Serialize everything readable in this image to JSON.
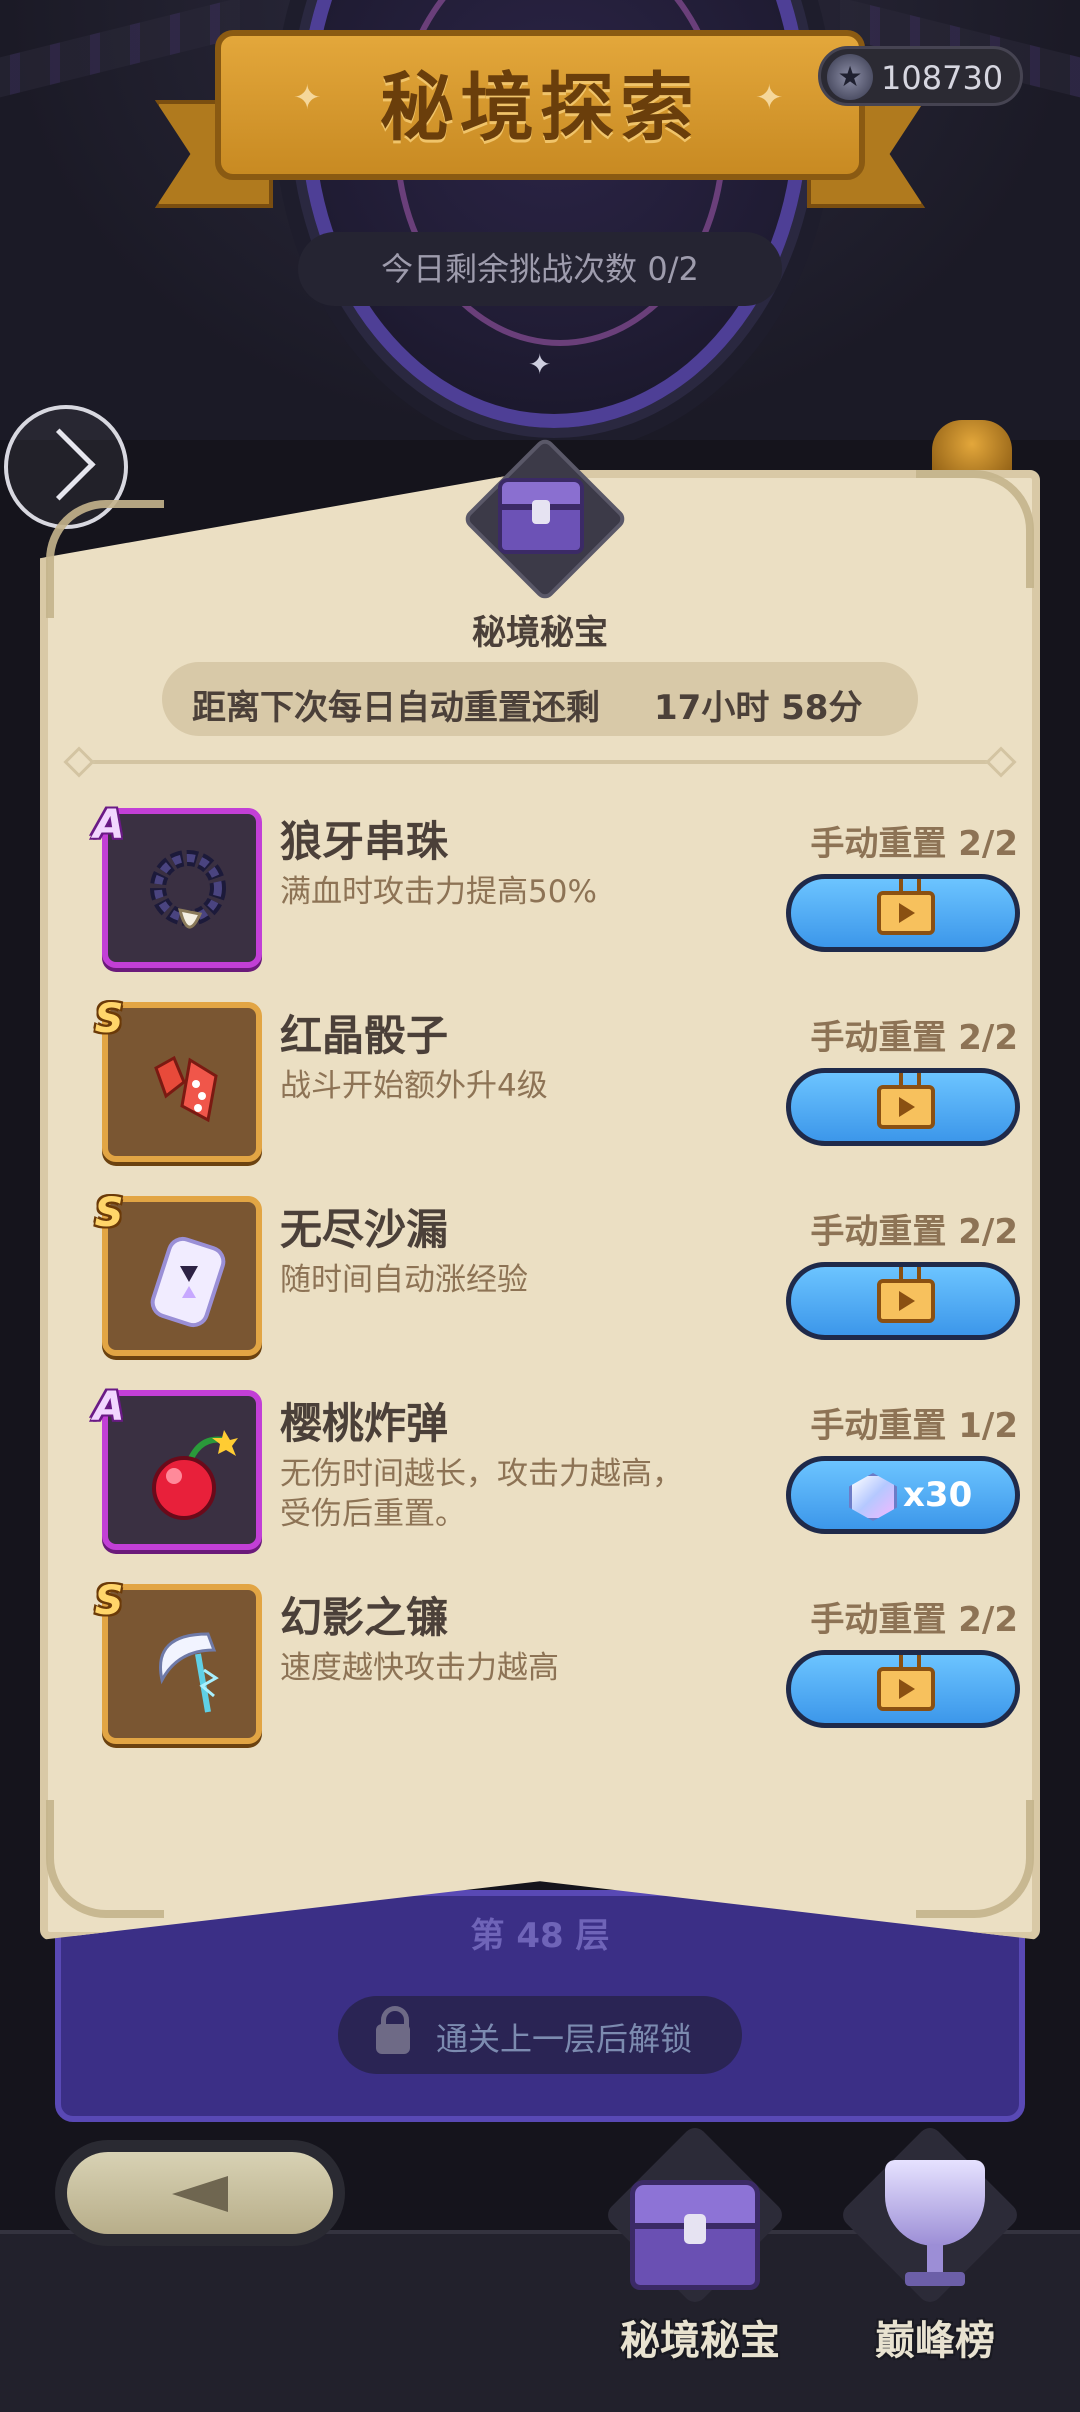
{
  "header": {
    "title": "秘境探索",
    "currency_value": "108730",
    "currency_icon": "star-coin-icon",
    "daily_attempts": "今日剩余挑战次数 0/2"
  },
  "card": {
    "title": "秘境秘宝",
    "reset_label": "距离下次每日自动重置还剩",
    "reset_time": "17小时 58分",
    "items": [
      {
        "grade": "A",
        "name": "狼牙串珠",
        "desc": "满血时攻击力提高50%",
        "reset": "手动重置 2/2",
        "action": "watch-ad",
        "icon": "fang-bead-icon"
      },
      {
        "grade": "S",
        "name": "红晶骰子",
        "desc": "战斗开始额外升4级",
        "reset": "手动重置 2/2",
        "action": "watch-ad",
        "icon": "red-crystal-dice-icon"
      },
      {
        "grade": "S",
        "name": "无尽沙漏",
        "desc": "随时间自动涨经验",
        "reset": "手动重置 2/2",
        "action": "watch-ad",
        "icon": "hourglass-icon"
      },
      {
        "grade": "A",
        "name": "樱桃炸弹",
        "desc": "无伤时间越长，攻击力越高，受伤后重置。",
        "reset": "手动重置 1/2",
        "action": "gem",
        "cost": "x30",
        "icon": "cherry-bomb-icon"
      },
      {
        "grade": "S",
        "name": "幻影之镰",
        "desc": "速度越快攻击力越高",
        "reset": "手动重置 2/2",
        "action": "watch-ad",
        "icon": "phantom-scythe-icon"
      }
    ]
  },
  "floor": {
    "label": "第 48 层",
    "lock_text": "通关上一层后解锁"
  },
  "bottom_nav": {
    "tab1": "秘境秘宝",
    "tab2": "巅峰榜"
  },
  "colors": {
    "card_bg": "#ebdfc3",
    "grade_a_border": "#c23fd6",
    "grade_s_border": "#e2a544",
    "button_blue": "#3c97ea",
    "banner_gold": "#e3a73b"
  }
}
